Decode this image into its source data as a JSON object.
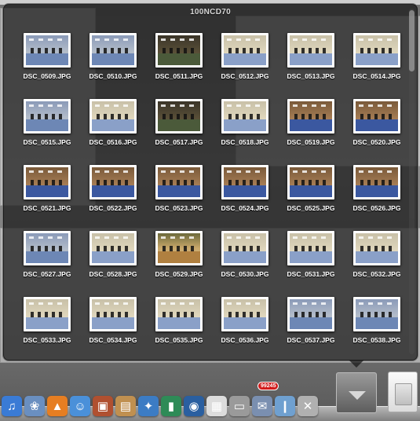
{
  "stack": {
    "folder_title": "100NCD70",
    "items": [
      {
        "label": "DSC_0509.JPG",
        "palette": "blue"
      },
      {
        "label": "DSC_0510.JPG",
        "palette": "blue"
      },
      {
        "label": "DSC_0511.JPG",
        "palette": "dark"
      },
      {
        "label": "DSC_0512.JPG",
        "palette": "cream"
      },
      {
        "label": "DSC_0513.JPG",
        "palette": "cream"
      },
      {
        "label": "DSC_0514.JPG",
        "palette": "cream"
      },
      {
        "label": "DSC_0515.JPG",
        "palette": "blue"
      },
      {
        "label": "DSC_0516.JPG",
        "palette": "cream"
      },
      {
        "label": "DSC_0517.JPG",
        "palette": "dark"
      },
      {
        "label": "DSC_0518.JPG",
        "palette": "cream"
      },
      {
        "label": "DSC_0519.JPG",
        "palette": "warm"
      },
      {
        "label": "DSC_0520.JPG",
        "palette": "warm"
      },
      {
        "label": "DSC_0521.JPG",
        "palette": "warm"
      },
      {
        "label": "DSC_0522.JPG",
        "palette": "warm"
      },
      {
        "label": "DSC_0523.JPG",
        "palette": "warm"
      },
      {
        "label": "DSC_0524.JPG",
        "palette": "warm"
      },
      {
        "label": "DSC_0525.JPG",
        "palette": "warm"
      },
      {
        "label": "DSC_0526.JPG",
        "palette": "warm"
      },
      {
        "label": "DSC_0527.JPG",
        "palette": "blue"
      },
      {
        "label": "DSC_0528.JPG",
        "palette": "cream"
      },
      {
        "label": "DSC_0529.JPG",
        "palette": "baby"
      },
      {
        "label": "DSC_0530.JPG",
        "palette": "cream"
      },
      {
        "label": "DSC_0531.JPG",
        "palette": "cream"
      },
      {
        "label": "DSC_0532.JPG",
        "palette": "cream"
      },
      {
        "label": "DSC_0533.JPG",
        "palette": "cream"
      },
      {
        "label": "DSC_0534.JPG",
        "palette": "cream"
      },
      {
        "label": "DSC_0535.JPG",
        "palette": "cream"
      },
      {
        "label": "DSC_0536.JPG",
        "palette": "cream"
      },
      {
        "label": "DSC_0537.JPG",
        "palette": "blue"
      },
      {
        "label": "DSC_0538.JPG",
        "palette": "blue"
      }
    ]
  },
  "dock": {
    "mail_badge": "99245",
    "icons": [
      {
        "name": "itunes-icon",
        "glyph": "♫",
        "color": "#3a7bd5"
      },
      {
        "name": "iphoto-icon",
        "glyph": "❀",
        "color": "#6a8fc0"
      },
      {
        "name": "vlc-icon",
        "glyph": "▲",
        "color": "#e67e22"
      },
      {
        "name": "finder-icon",
        "glyph": "☺",
        "color": "#4a90d9"
      },
      {
        "name": "preview-icon",
        "glyph": "▣",
        "color": "#b05030"
      },
      {
        "name": "photo-browser-icon",
        "glyph": "▤",
        "color": "#c09050"
      },
      {
        "name": "safari-icon",
        "glyph": "✦",
        "color": "#3c7cc4"
      },
      {
        "name": "activity-monitor-icon",
        "glyph": "▮",
        "color": "#2e8b57"
      },
      {
        "name": "dvd-player-icon",
        "glyph": "◉",
        "color": "#2a5fa0"
      },
      {
        "name": "calendar-icon",
        "glyph": "▦",
        "color": "#dcdcdc"
      },
      {
        "name": "printer-icon",
        "glyph": "▭",
        "color": "#9a9a9a"
      },
      {
        "name": "mail-icon",
        "glyph": "✉",
        "color": "#7a8fb0"
      },
      {
        "name": "network-icon",
        "glyph": "❙",
        "color": "#6fa0d0"
      },
      {
        "name": "utility-icon",
        "glyph": "✕",
        "color": "#b0b0b0"
      }
    ]
  }
}
